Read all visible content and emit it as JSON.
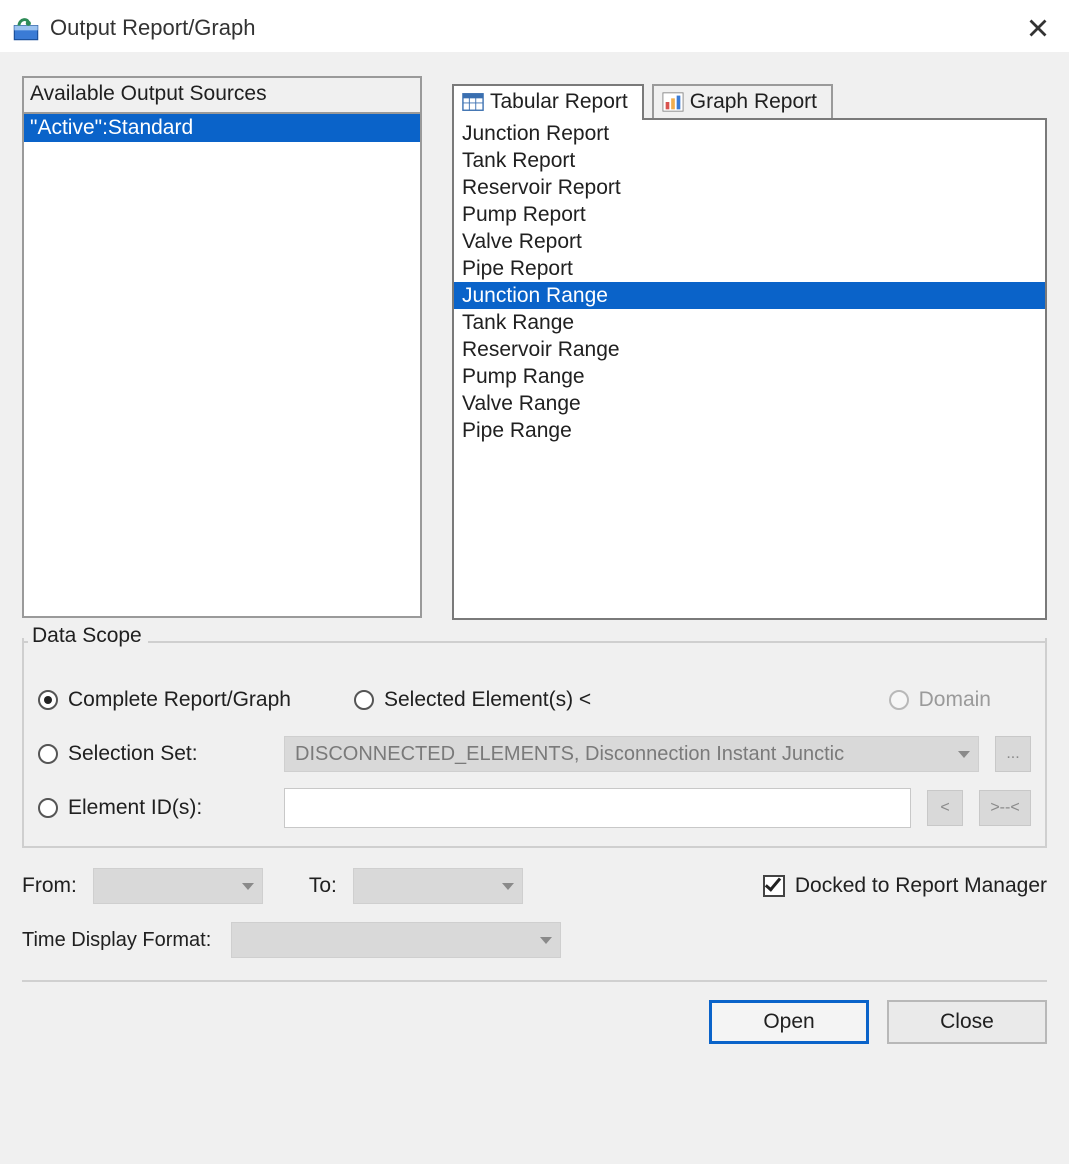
{
  "window": {
    "title": "Output Report/Graph"
  },
  "left_panel": {
    "header": "Available Output Sources",
    "items": [
      {
        "label": "\"Active\":Standard",
        "selected": true
      }
    ]
  },
  "tabs": [
    {
      "label": "Tabular Report",
      "active": true,
      "icon": "table-icon"
    },
    {
      "label": "Graph Report",
      "active": false,
      "icon": "chart-icon"
    }
  ],
  "report_list": {
    "items": [
      {
        "label": "Junction Report",
        "selected": false
      },
      {
        "label": "Tank Report",
        "selected": false
      },
      {
        "label": "Reservoir Report",
        "selected": false
      },
      {
        "label": "Pump Report",
        "selected": false
      },
      {
        "label": "Valve Report",
        "selected": false
      },
      {
        "label": "Pipe Report",
        "selected": false
      },
      {
        "label": "Junction Range",
        "selected": true
      },
      {
        "label": "Tank Range",
        "selected": false
      },
      {
        "label": "Reservoir Range",
        "selected": false
      },
      {
        "label": "Pump Range",
        "selected": false
      },
      {
        "label": "Valve Range",
        "selected": false
      },
      {
        "label": "Pipe Range",
        "selected": false
      }
    ]
  },
  "data_scope": {
    "title": "Data Scope",
    "options": {
      "complete": {
        "label": "Complete Report/Graph",
        "checked": true,
        "disabled": false
      },
      "selected_elements": {
        "label": "Selected Element(s) <",
        "checked": false,
        "disabled": false
      },
      "domain": {
        "label": "Domain",
        "checked": false,
        "disabled": true
      },
      "selection_set": {
        "label": "Selection Set:",
        "checked": false,
        "disabled": false
      },
      "element_ids": {
        "label": "Element ID(s):",
        "checked": false,
        "disabled": false
      }
    },
    "selection_set_value": "DISCONNECTED_ELEMENTS, Disconnection Instant Junctic",
    "selection_set_more_label": "...",
    "element_ids_value": "",
    "element_ids_btn_prev": "<",
    "element_ids_btn_pick": ">--<"
  },
  "time": {
    "from_label": "From:",
    "from_value": "",
    "to_label": "To:",
    "to_value": "",
    "format_label": "Time Display Format:",
    "format_value": ""
  },
  "docked": {
    "label": "Docked to Report Manager",
    "checked": true
  },
  "buttons": {
    "open": "Open",
    "close": "Close"
  }
}
